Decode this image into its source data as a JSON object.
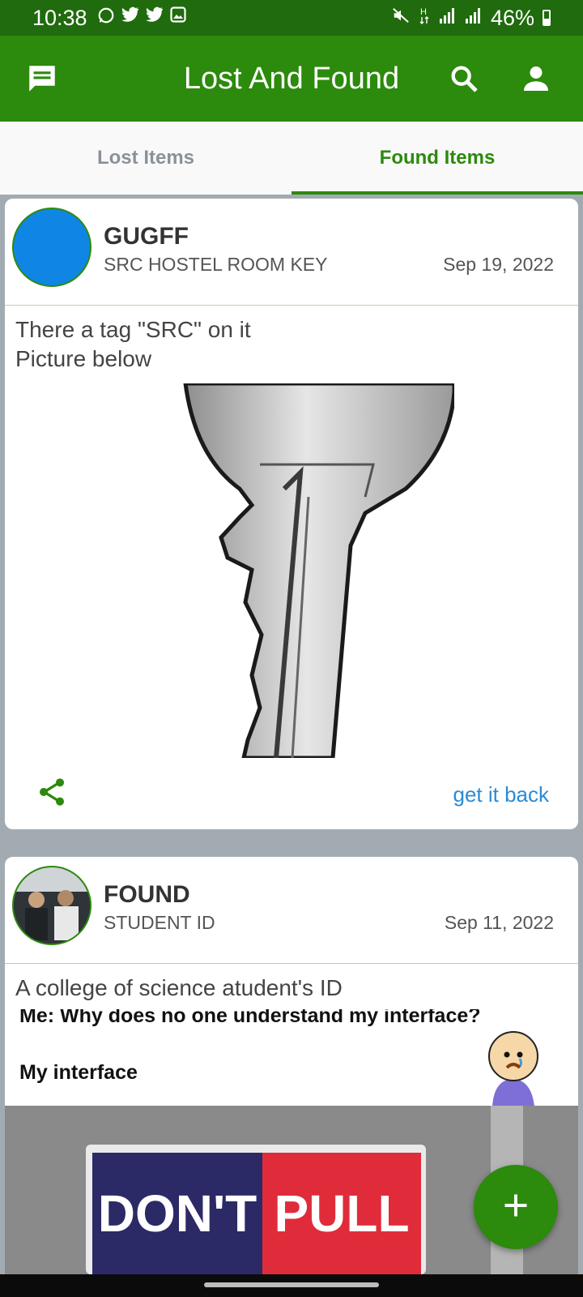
{
  "status": {
    "time": "10:38",
    "battery": "46%",
    "battery_level": 0.46
  },
  "app": {
    "title": "Lost And Found"
  },
  "tabs": [
    {
      "label": "Lost Items",
      "active": false
    },
    {
      "label": "Found Items",
      "active": true
    }
  ],
  "posts": [
    {
      "name": "GUGFF",
      "item": "SRC HOSTEL ROOM KEY",
      "date": "Sep 19, 2022",
      "desc_line1": "There a tag \"SRC\" on it",
      "desc_line2": "Picture below",
      "action": "get it back"
    },
    {
      "name": "FOUND",
      "item": "STUDENT ID",
      "date": "Sep 11, 2022",
      "desc_line1": "A college of science atudent's ID",
      "meme_line1": "Me: Why does no one understand my interface?",
      "meme_line2": "My interface",
      "sign_left": "DON'T",
      "sign_right": "PULL"
    }
  ],
  "colors": {
    "primary": "#2c8a0c",
    "status_bar": "#1f6b0d",
    "link": "#2a8bd6"
  }
}
